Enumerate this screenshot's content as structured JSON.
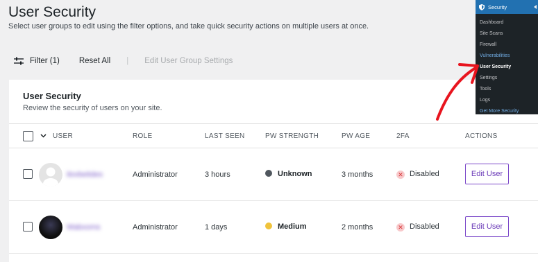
{
  "header": {
    "title": "User Security",
    "subtitle": "Select user groups to edit using the filter options, and take quick security actions on multiple users at once."
  },
  "toolbar": {
    "filter_label": "Filter (1)",
    "reset_label": "Reset All",
    "separator": "|",
    "edit_group_label": "Edit User Group Settings"
  },
  "card": {
    "title": "User Security",
    "subtitle": "Review the security of users on your site."
  },
  "table": {
    "columns": {
      "user": "USER",
      "role": "ROLE",
      "last_seen": "LAST SEEN",
      "pw_strength": "PW STRENGTH",
      "pw_age": "PW AGE",
      "twofa": "2FA",
      "actions": "ACTIONS"
    },
    "rows": [
      {
        "username": "ilovbeitdes",
        "role": "Administrator",
        "last_seen": "3 hours",
        "pw_strength": "Unknown",
        "pw_strength_color": "#50575e",
        "pw_age": "3 months",
        "twofa": "Disabled",
        "twofa_icon": "✕",
        "action": "Edit User"
      },
      {
        "username": "Wabxoms",
        "role": "Administrator",
        "last_seen": "1 days",
        "pw_strength": "Medium",
        "pw_strength_color": "#f0c33c",
        "pw_age": "2 months",
        "twofa": "Disabled",
        "twofa_icon": "✕",
        "action": "Edit User"
      }
    ]
  },
  "admin_menu": {
    "header": "Security",
    "items": [
      "Dashboard",
      "Site Scans",
      "Firewall",
      "Vulnerabilities",
      "User Security",
      "Settings",
      "Tools",
      "Logs",
      "Get More Security"
    ]
  },
  "colors": {
    "accent": "#7b48c9",
    "wp_blue": "#2271b1",
    "annotation_arrow": "#e8141e"
  }
}
